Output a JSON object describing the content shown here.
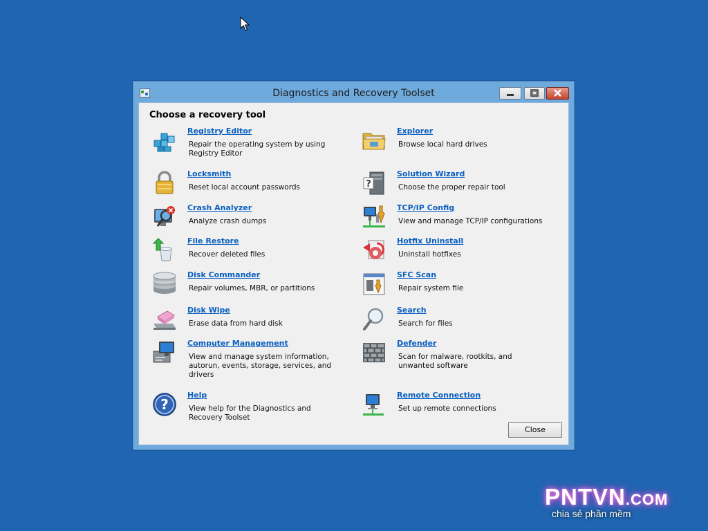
{
  "window": {
    "title": "Diagnostics and Recovery Toolset"
  },
  "heading": "Choose a recovery tool",
  "tools": [
    {
      "name": "Registry Editor",
      "desc": "Repair the operating system by using Registry Editor",
      "icon": "registry-icon"
    },
    {
      "name": "Explorer",
      "desc": "Browse local hard drives",
      "icon": "folder-icon"
    },
    {
      "name": "Locksmith",
      "desc": "Reset local account passwords",
      "icon": "padlock-icon"
    },
    {
      "name": "Solution Wizard",
      "desc": "Choose the proper repair tool",
      "icon": "wizard-icon"
    },
    {
      "name": "Crash Analyzer",
      "desc": "Analyze crash dumps",
      "icon": "crash-analyzer-icon"
    },
    {
      "name": "TCP/IP Config",
      "desc": "View and manage TCP/IP configurations",
      "icon": "network-config-icon"
    },
    {
      "name": "File Restore",
      "desc": "Recover deleted files",
      "icon": "recycle-bin-icon"
    },
    {
      "name": "Hotfix Uninstall",
      "desc": "Uninstall hotfixes",
      "icon": "hotfix-icon"
    },
    {
      "name": "Disk Commander",
      "desc": "Repair volumes, MBR, or partitions",
      "icon": "disk-stack-icon"
    },
    {
      "name": "SFC Scan",
      "desc": "Repair system file",
      "icon": "system-file-icon"
    },
    {
      "name": "Disk Wipe",
      "desc": "Erase data from hard disk",
      "icon": "eraser-icon"
    },
    {
      "name": "Search",
      "desc": "Search for files",
      "icon": "magnifier-icon"
    },
    {
      "name": "Computer Management",
      "desc": "View and manage system information, autorun, events, storage, services, and drivers",
      "icon": "computer-management-icon"
    },
    {
      "name": "Defender",
      "desc": "Scan for malware, rootkits, and unwanted software",
      "icon": "brick-wall-icon"
    },
    {
      "name": "Help",
      "desc": "View help for the Diagnostics and Recovery Toolset",
      "icon": "help-icon"
    },
    {
      "name": "Remote Connection",
      "desc": "Set up remote connections",
      "icon": "remote-computer-icon"
    }
  ],
  "close_label": "Close",
  "watermark": {
    "main": "PNTVN",
    "suffix": ".COM",
    "tagline": "chia sẻ phần mềm"
  },
  "colors": {
    "desktop": "#1f65b1",
    "link": "#0a5fc0",
    "window_frame": "#6faadd"
  }
}
